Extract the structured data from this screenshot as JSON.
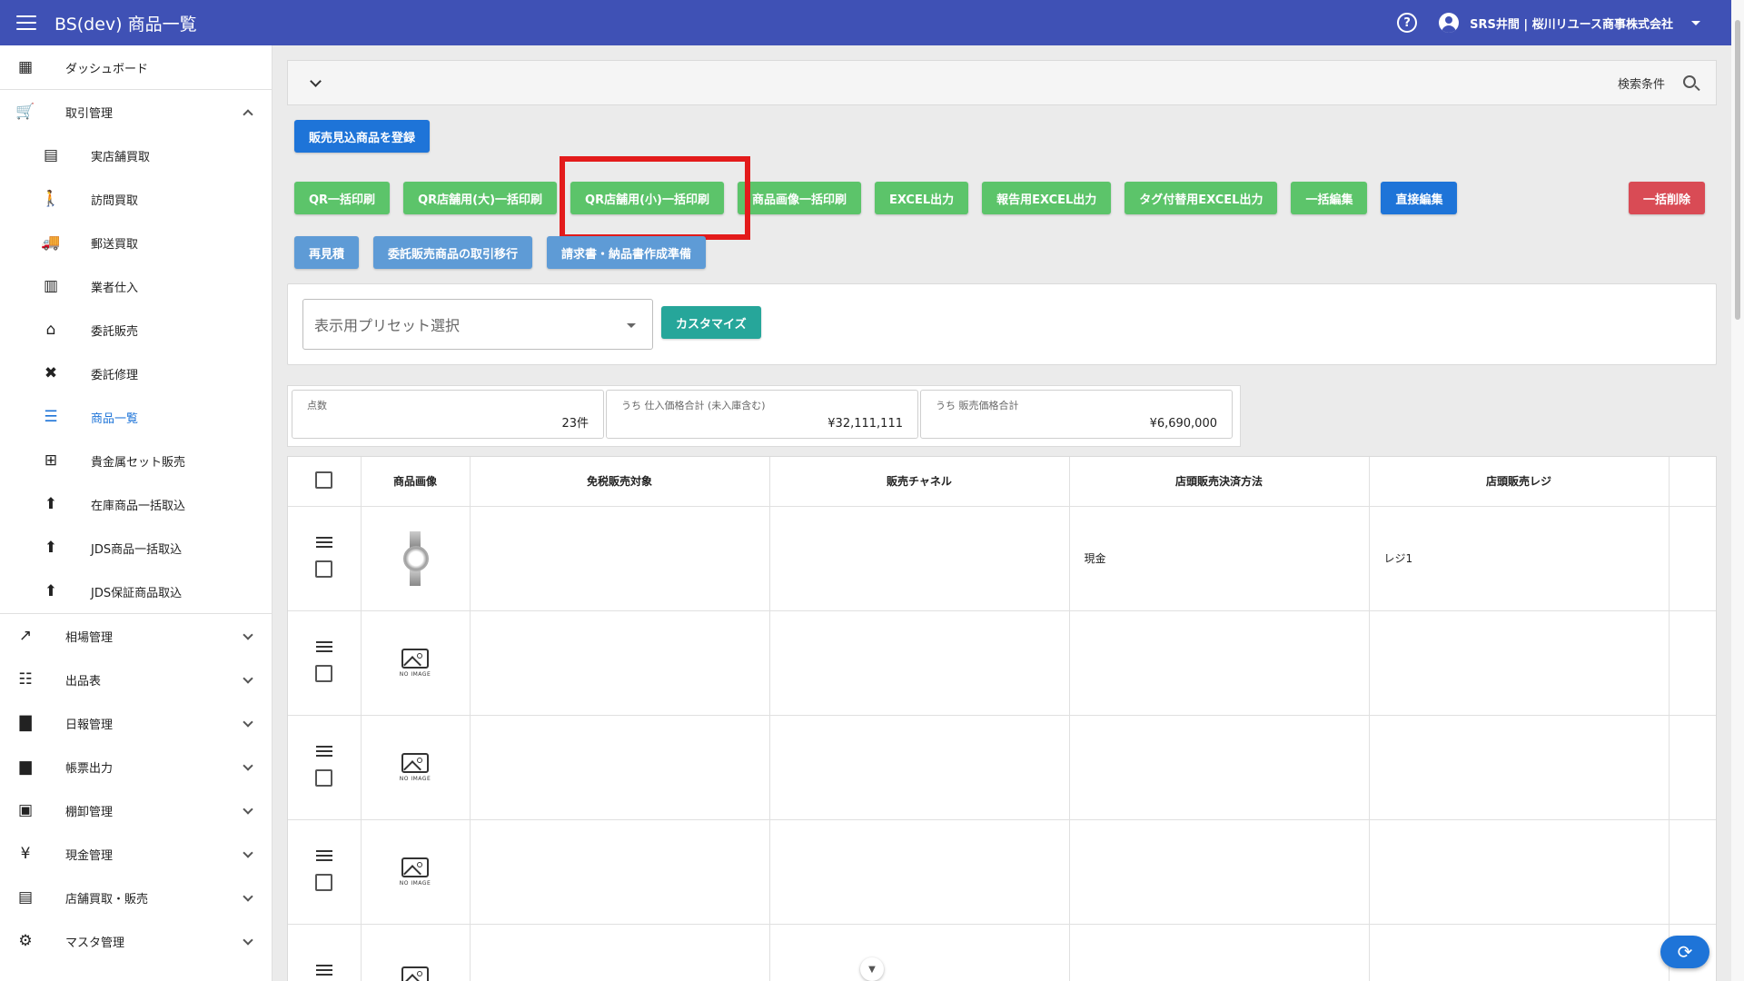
{
  "app": {
    "title": "BS(dev) 商品一覧",
    "user": "SRS井間 | 桜川リユース商事株式会社"
  },
  "sidebar": {
    "dashboard": "ダッシュボード",
    "trade": "取引管理",
    "trade_items": [
      "実店舗買取",
      "訪問買取",
      "郵送買取",
      "業者仕入",
      "委託販売",
      "委託修理",
      "商品一覧",
      "貴金属セット販売",
      "在庫商品一括取込",
      "JDS商品一括取込",
      "JDS保証商品取込"
    ],
    "sections": [
      "相場管理",
      "出品表",
      "日報管理",
      "帳票出力",
      "棚卸管理",
      "現金管理",
      "店舗買取・販売",
      "マスタ管理"
    ]
  },
  "search": {
    "label": "検索条件"
  },
  "buttons": {
    "register": "販売見込商品を登録",
    "row1": [
      "QR一括印刷",
      "QR店舗用(大)一括印刷",
      "QR店舗用(小)一括印刷",
      "商品画像一括印刷",
      "EXCEL出力",
      "報告用EXCEL出力",
      "タグ付替用EXCEL出力",
      "一括編集",
      "直接編集"
    ],
    "delete": "一括削除",
    "row2": [
      "再見積",
      "委託販売商品の取引移行",
      "請求書・納品書作成準備"
    ],
    "customize": "カスタマイズ"
  },
  "preset": {
    "placeholder": "表示用プリセット選択"
  },
  "summary": [
    {
      "label": "点数",
      "value": "23件"
    },
    {
      "label": "うち 仕入価格合計 (未入庫含む)",
      "value": "¥32,111,111"
    },
    {
      "label": "うち 販売価格合計",
      "value": "¥6,690,000"
    }
  ],
  "table": {
    "headers": [
      "商品画像",
      "免税販売対象",
      "販売チャネル",
      "店頭販売決済方法",
      "店頭販売レジ"
    ],
    "rows": [
      {
        "image": "watch",
        "payment": "現金",
        "register": "レジ1"
      },
      {
        "image": "none",
        "payment": "",
        "register": ""
      },
      {
        "image": "none",
        "payment": "",
        "register": ""
      },
      {
        "image": "none",
        "payment": "",
        "register": ""
      },
      {
        "image": "none",
        "payment": "",
        "register": ""
      }
    ],
    "no_image_text": "NO IMAGE"
  },
  "colors": {
    "header": "#3f51b5",
    "primary": "#1e74d8",
    "success": "#5cc46a",
    "danger": "#d94b55",
    "highlight": "#e31b1b"
  }
}
